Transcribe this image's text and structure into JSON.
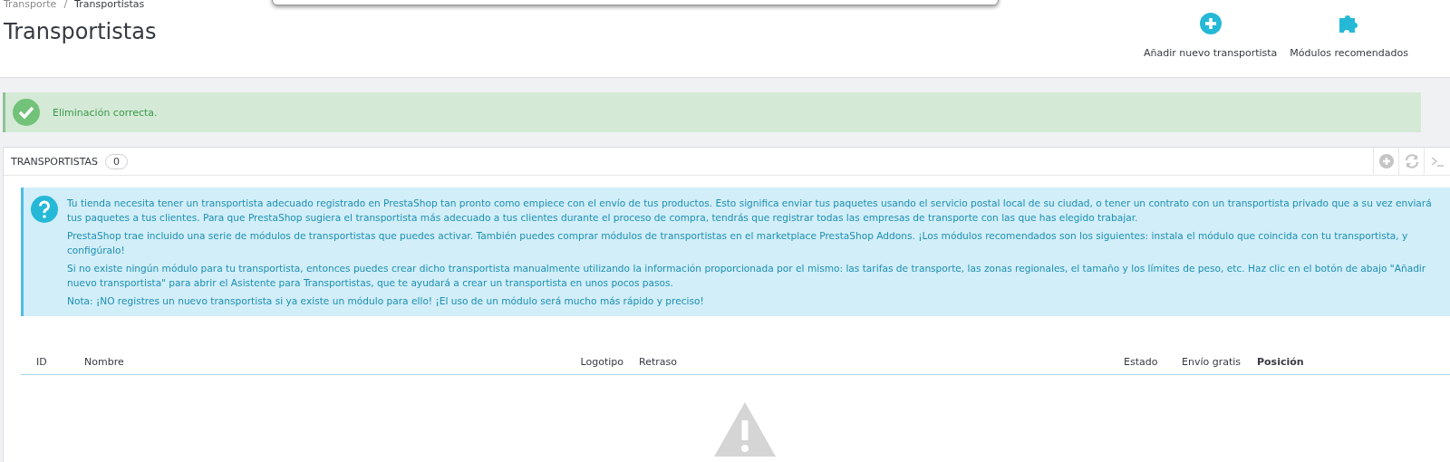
{
  "breadcrumb": [
    {
      "label": "Transporte",
      "current": false
    },
    {
      "label": "Transportistas",
      "current": true
    }
  ],
  "breadcrumb_separator": "/",
  "page_title": "Transportistas",
  "toolbar": [
    {
      "kind": "add",
      "label": "Añadir nuevo transportista"
    },
    {
      "kind": "modules",
      "label": "Módulos recomendados"
    }
  ],
  "alert": {
    "message": "Eliminación correcta."
  },
  "panel": {
    "title": "TRANSPORTISTAS",
    "count": "0",
    "info": [
      "Tu tienda necesita tener un transportista adecuado registrado en PrestaShop tan pronto como empiece con el envío de tus productos. Esto significa enviar tus paquetes usando el servicio postal local de su ciudad, o tener un contrato con un transportista privado que a su vez enviará tus paquetes a tus clientes. Para que PrestaShop sugiera el transportista más adecuado a tus clientes durante el proceso de compra, tendrás que registrar todas las empresas de transporte con las que has elegido trabajar.",
      "PrestaShop trae incluido una serie de módulos de transportistas que puedes activar. También puedes comprar módulos de transportistas en el marketplace PrestaShop Addons. ¡Los módulos recomendados son los siguientes: instala el módulo que coincida con tu transportista, y configúralo!",
      "Si no existe ningún módulo para tu transportista, entonces puedes crear dicho transportista manualmente utilizando la información proporcionada por el mismo: las tarifas de transporte, las zonas regionales, el tamaño y los límites de peso, etc. Haz clic en el botón de abajo \"Añadir nuevo transportista\" para abrir el Asistente para Transportistas, que te ayudará a crear un transportista en unos pocos pasos.",
      "Nota: ¡NO registres un nuevo transportista si ya existe un módulo para ello! ¡El uso de un módulo será mucho más rápido y preciso!"
    ],
    "columns": [
      {
        "label": "ID",
        "sorted": false
      },
      {
        "label": "Nombre",
        "sorted": false
      },
      {
        "label": "Logotipo",
        "sorted": false
      },
      {
        "label": "Retraso",
        "sorted": false
      },
      {
        "label": "Estado",
        "sorted": false
      },
      {
        "label": "Envío gratis",
        "sorted": false
      },
      {
        "label": "Posición",
        "sorted": true
      }
    ]
  }
}
